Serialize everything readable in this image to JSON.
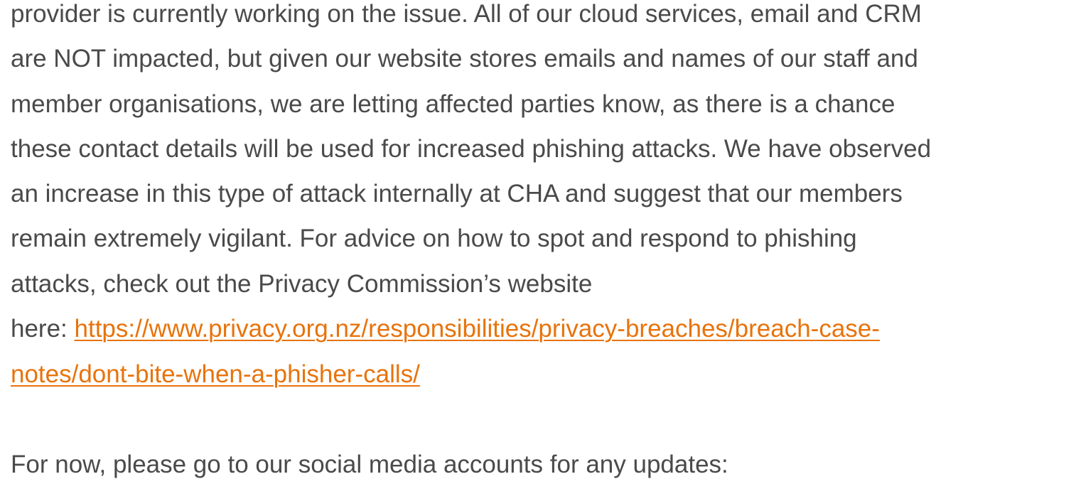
{
  "article": {
    "lines": [
      "provider is currently working on the issue. All of our cloud services, email and CRM",
      "are NOT impacted, but given our website stores emails and names of our staff and",
      "member organisations, we are letting affected parties know, as there is a chance",
      "these contact details will be used for increased phishing attacks. We have observed",
      "an increase in this type of attack internally at CHA and suggest that our members",
      "remain extremely vigilant. For advice on how to spot and respond to phishing",
      "attacks, check out the Privacy Commission’s website"
    ],
    "here_prefix": "here: ",
    "link_part1": "https://www.privacy.org.nz/responsibilities/privacy-breaches/breach-case-",
    "link_part2": "notes/dont-bite-when-a-phisher-calls/",
    "social_text": "For now, please go to our social media accounts for any updates:"
  },
  "colors": {
    "text": "#4a4a4a",
    "link": "#e8730c",
    "background": "#ffffff"
  }
}
